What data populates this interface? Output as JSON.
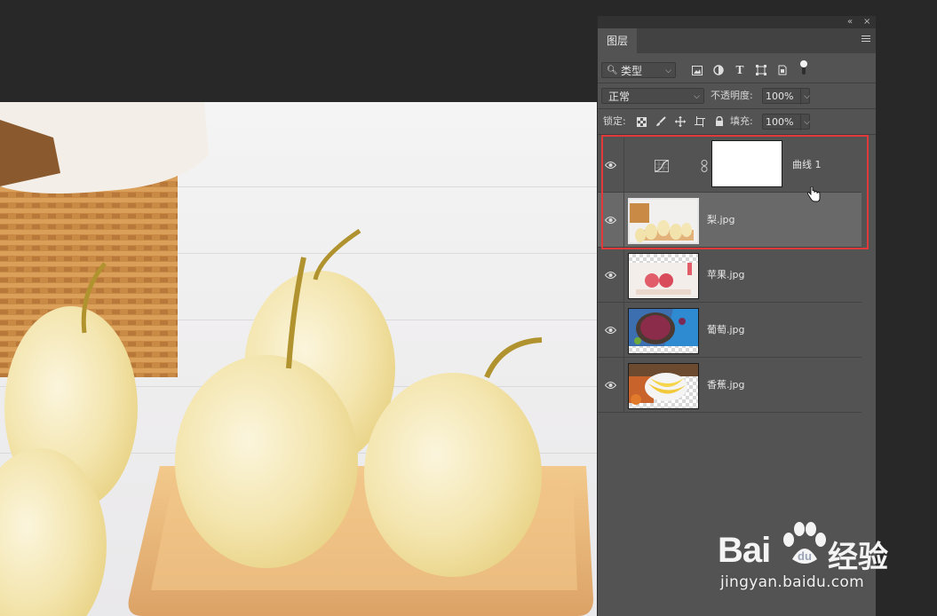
{
  "panel": {
    "collapse_glyph": "«",
    "close_glyph": "×",
    "tab_label": "图层",
    "menu_icon": "hamburger-menu-icon"
  },
  "filter_row": {
    "filter_type": "类型",
    "filter_icons": [
      "image-filter-icon",
      "adjustment-filter-icon",
      "type-filter-icon",
      "shape-filter-icon",
      "smart-object-filter-icon",
      "filter-toggle-icon"
    ]
  },
  "blend_row": {
    "blend_mode": "正常",
    "opacity_label": "不透明度:",
    "opacity_value": "100%"
  },
  "lock_row": {
    "lock_label": "锁定:",
    "lock_icons": [
      "lock-transparent-icon",
      "lock-image-icon",
      "lock-position-icon",
      "lock-artboard-icon",
      "lock-all-icon"
    ],
    "fill_label": "填充:",
    "fill_value": "100%"
  },
  "layers": [
    {
      "name": "曲线 1",
      "type": "adjustment",
      "visible": true,
      "selected": false
    },
    {
      "name": "梨.jpg",
      "type": "image",
      "visible": true,
      "selected": true
    },
    {
      "name": "苹果.jpg",
      "type": "image",
      "visible": true,
      "selected": false
    },
    {
      "name": "葡萄.jpg",
      "type": "image",
      "visible": true,
      "selected": false
    },
    {
      "name": "香蕉.jpg",
      "type": "image",
      "visible": true,
      "selected": false
    }
  ],
  "watermark": {
    "brand_left": "Bai",
    "brand_right": "经验",
    "url": "jingyan.baidu.com"
  },
  "colors": {
    "selection_highlight": "#e03a3a",
    "panel_bg": "#535353",
    "workspace_bg": "#282828"
  }
}
